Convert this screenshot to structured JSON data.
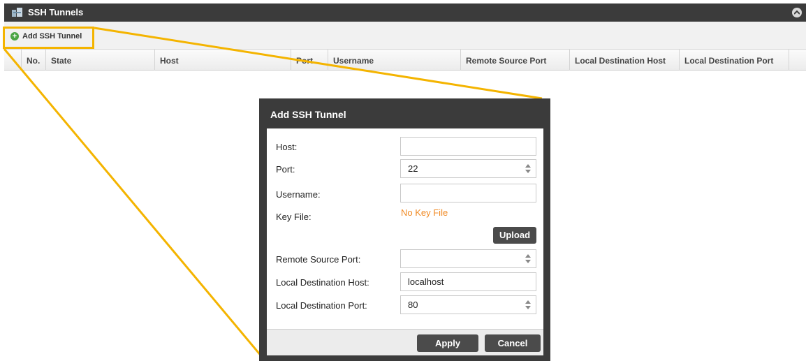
{
  "panel": {
    "title": "SSH Tunnels",
    "icon": "tunnel-icon",
    "collapse_icon": "chevron-up-icon"
  },
  "toolbar": {
    "add_label": "Add SSH Tunnel",
    "add_icon": "plus-icon"
  },
  "table": {
    "columns": [
      "No.",
      "State",
      "Host",
      "Port",
      "Username",
      "Remote Source Port",
      "Local Destination Host",
      "Local Destination Port"
    ],
    "rows": []
  },
  "dialog": {
    "title": "Add SSH Tunnel",
    "fields": {
      "host": {
        "label": "Host:",
        "value": ""
      },
      "port": {
        "label": "Port:",
        "value": "22"
      },
      "username": {
        "label": "Username:",
        "value": ""
      },
      "key_file": {
        "label": "Key File:",
        "value": "No Key File"
      },
      "remote_source_port": {
        "label": "Remote Source Port:",
        "value": ""
      },
      "local_dest_host": {
        "label": "Local Destination Host:",
        "value": "localhost"
      },
      "local_dest_port": {
        "label": "Local Destination Port:",
        "value": "80"
      }
    },
    "upload_label": "Upload",
    "apply_label": "Apply",
    "cancel_label": "Cancel"
  },
  "colors": {
    "header_bg": "#3b3b3b",
    "highlight": "#f4b400",
    "nokey_text": "#f08a24",
    "add_icon": "#4aa544"
  }
}
